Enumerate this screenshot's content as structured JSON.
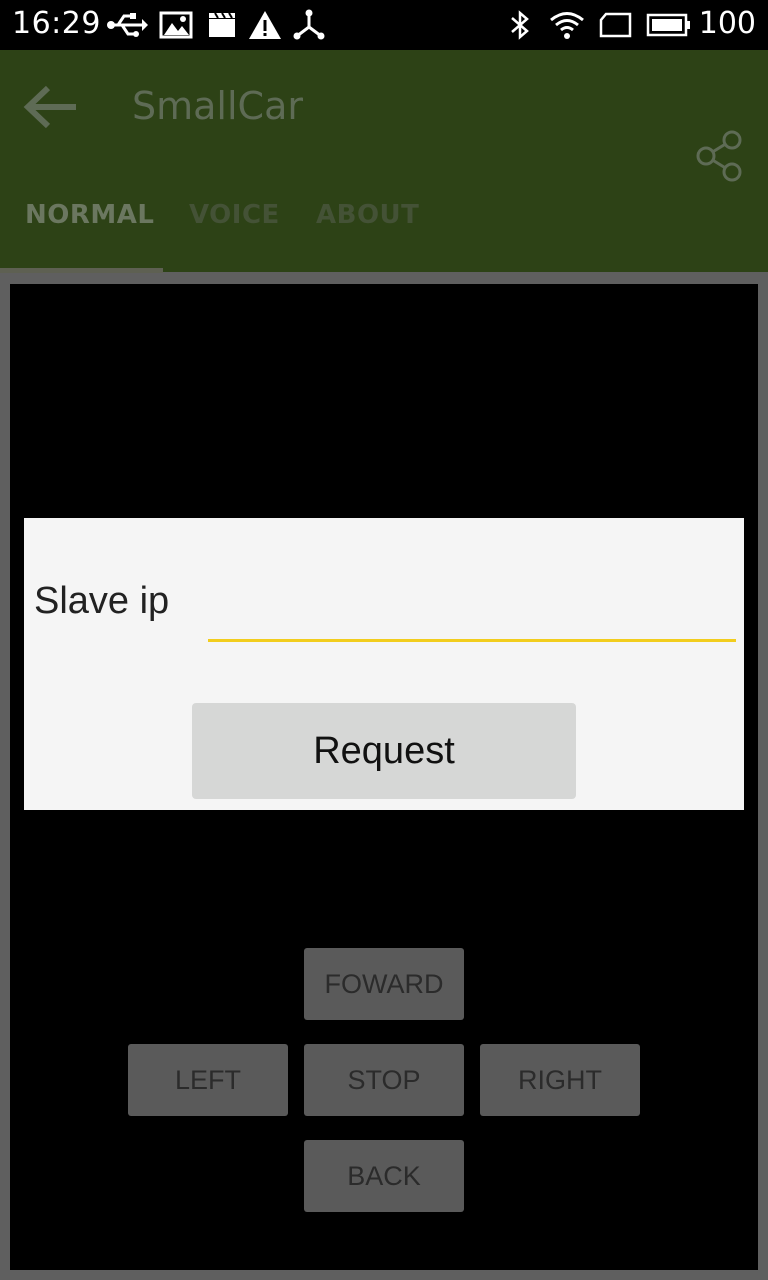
{
  "status_bar": {
    "time": "16:29",
    "battery_percent": "100",
    "icons": [
      "usb-icon",
      "image-icon",
      "clapperboard-icon",
      "warning-icon",
      "share-hub-icon",
      "bluetooth-icon",
      "wifi-icon",
      "sim-icon",
      "battery-icon"
    ]
  },
  "app_bar": {
    "title": "SmallCar",
    "back_icon": "arrow-back-icon",
    "share_icon": "share-icon",
    "color": "#2d4216"
  },
  "tabs": [
    {
      "label": "NORMAL",
      "selected": true
    },
    {
      "label": "VOICE",
      "selected": false
    },
    {
      "label": "ABOUT",
      "selected": false
    }
  ],
  "dialog": {
    "label": "Slave ip",
    "input_value": "",
    "input_underline_color": "#f2cd1d",
    "button_label": "Request"
  },
  "controls": {
    "forward": "FOWARD",
    "left": "LEFT",
    "stop": "STOP",
    "right": "RIGHT",
    "back": "BACK"
  }
}
